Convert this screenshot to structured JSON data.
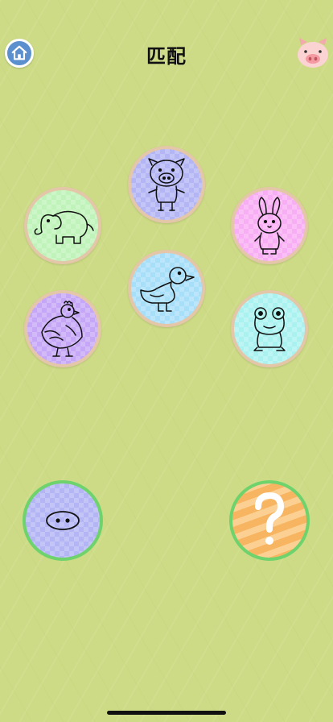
{
  "header": {
    "title": "匹配",
    "home_icon": "home-icon",
    "pig_icon": "pig-face-icon"
  },
  "choices": [
    {
      "animal": "pig",
      "icon": "pig-line-icon",
      "bg": "#b3b5f5"
    },
    {
      "animal": "elephant",
      "icon": "elephant-line-icon",
      "bg": "#bff3b9"
    },
    {
      "animal": "rabbit",
      "icon": "rabbit-line-icon",
      "bg": "#f8aef4"
    },
    {
      "animal": "duck",
      "icon": "duck-line-icon",
      "bg": "#a7def8"
    },
    {
      "animal": "hen",
      "icon": "hen-line-icon",
      "bg": "#c5a6f7"
    },
    {
      "animal": "frog",
      "icon": "frog-line-icon",
      "bg": "#a9f2ef"
    }
  ],
  "targets": [
    {
      "hint": "pig-nose",
      "icon": "pig-nose-icon",
      "bg": "#b3b5f5"
    },
    {
      "hint": "mystery",
      "icon": "question-mark-icon",
      "text": "?",
      "bg": "#f7b561"
    }
  ],
  "colors": {
    "background": "#cddb86",
    "choice_border": "#e4c7a9",
    "target_border": "#6ed36c",
    "home_button": "#5b8fce"
  }
}
